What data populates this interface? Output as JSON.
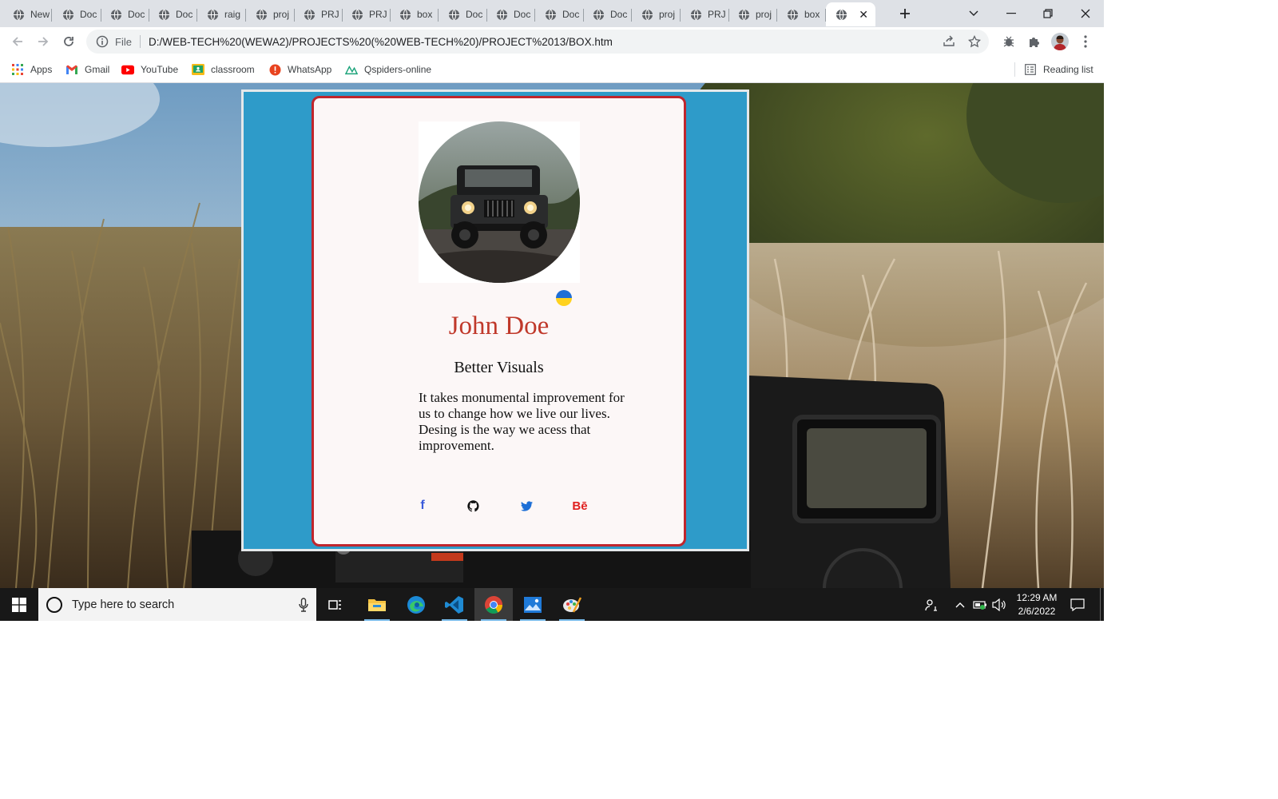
{
  "browser": {
    "tabs": [
      {
        "label": "New"
      },
      {
        "label": "Doc"
      },
      {
        "label": "Doc"
      },
      {
        "label": "Doc"
      },
      {
        "label": "raig"
      },
      {
        "label": "proj"
      },
      {
        "label": "PRJ"
      },
      {
        "label": "PRJ"
      },
      {
        "label": "box"
      },
      {
        "label": "Doc"
      },
      {
        "label": "Doc"
      },
      {
        "label": "Doc"
      },
      {
        "label": "Doc"
      },
      {
        "label": "proj"
      },
      {
        "label": "PRJ"
      },
      {
        "label": "proj"
      },
      {
        "label": "box"
      },
      {
        "label": "",
        "active": true
      }
    ],
    "address": {
      "scheme_label": "File",
      "url": "D:/WEB-TECH%20(WEWA2)/PROJECTS%20(%20WEB-TECH%20)/PROJECT%2013/BOX.htm"
    },
    "bookmarks": [
      {
        "label": "Apps",
        "icon": "apps-grid-icon"
      },
      {
        "label": "Gmail",
        "icon": "gmail-icon"
      },
      {
        "label": "YouTube",
        "icon": "youtube-icon"
      },
      {
        "label": "classroom",
        "icon": "classroom-icon"
      },
      {
        "label": "WhatsApp",
        "icon": "whatsapp-icon"
      },
      {
        "label": "Qspiders-online",
        "icon": "qspiders-icon"
      }
    ],
    "reading_list": "Reading list"
  },
  "card": {
    "name": "John Doe",
    "tagline": "Better Visuals",
    "bio": "It takes monumental improvement for us to change how we live our lives. Desing is the way we acess that improvement.",
    "status_dot_colors": {
      "top": "#1f6fd6",
      "bottom": "#ffd21f"
    },
    "social": [
      {
        "label": "f",
        "icon": "facebook-icon"
      },
      {
        "icon": "github-icon"
      },
      {
        "icon": "twitter-icon"
      },
      {
        "label": "Bē",
        "icon": "behance-icon"
      }
    ]
  },
  "colors": {
    "outer_box_bg": "#2e9bc9",
    "card_border": "#c0262d",
    "name_color": "#c0392b"
  },
  "taskbar": {
    "search_placeholder": "Type here to search",
    "clock_time": "12:29 AM",
    "clock_date": "2/6/2022"
  }
}
